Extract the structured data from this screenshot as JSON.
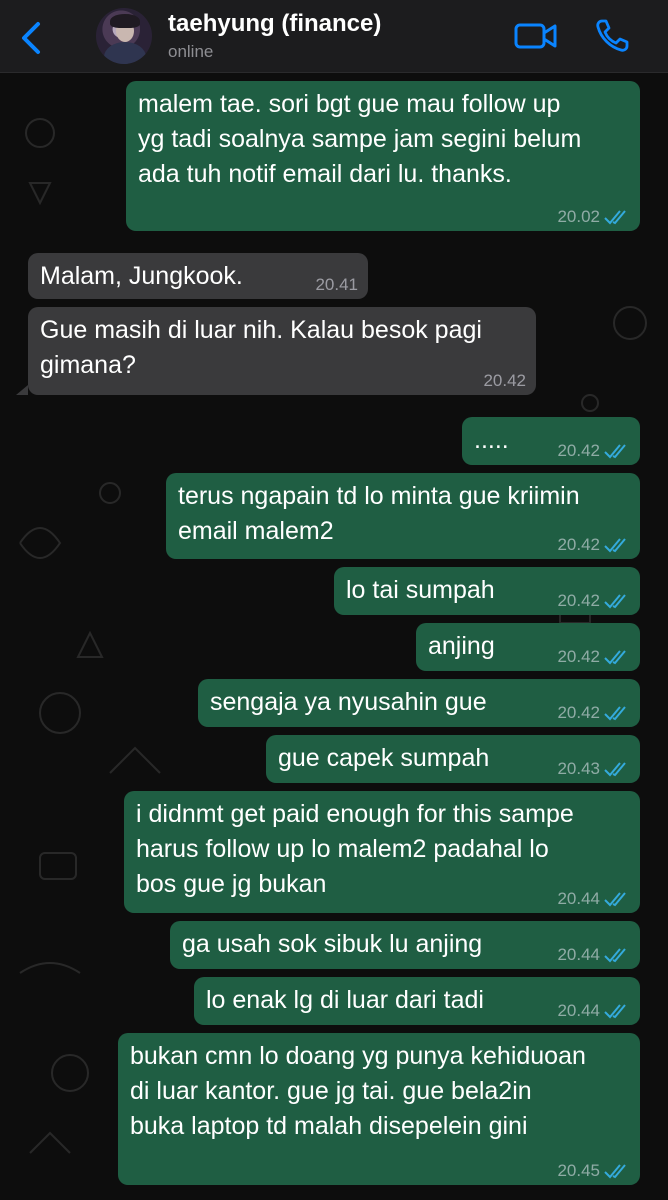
{
  "header": {
    "name": "taehyung (finance)",
    "status": "online"
  },
  "colors": {
    "outgoing_bubble": "#1f5e43",
    "incoming_bubble": "#3a3a3c",
    "accent": "#0a84ff",
    "read_check": "#34aadc"
  },
  "icons": {
    "back": "chevron-left-icon",
    "video": "video-camera-icon",
    "call": "phone-icon",
    "read": "double-check-icon"
  },
  "messages": [
    {
      "dir": "out",
      "text": "malem tae. sori bgt gue mau follow up\nyg tadi soalnya sampe jam segini belum\nada tuh notif email dari lu. thanks.",
      "time": "20.02",
      "read": true
    },
    {
      "dir": "in",
      "text": "Malam, Jungkook.",
      "time": "20.41"
    },
    {
      "dir": "in",
      "text": "Gue masih di luar nih. Kalau besok pagi\ngimana?",
      "time": "20.42"
    },
    {
      "dir": "out",
      "text": ".....",
      "time": "20.42",
      "read": true
    },
    {
      "dir": "out",
      "text": "terus ngapain td lo minta gue kriimin\nemail malem2",
      "time": "20.42",
      "read": true
    },
    {
      "dir": "out",
      "text": "lo tai sumpah",
      "time": "20.42",
      "read": true
    },
    {
      "dir": "out",
      "text": "anjing",
      "time": "20.42",
      "read": true
    },
    {
      "dir": "out",
      "text": "sengaja ya nyusahin gue",
      "time": "20.42",
      "read": true
    },
    {
      "dir": "out",
      "text": "gue capek sumpah",
      "time": "20.43",
      "read": true
    },
    {
      "dir": "out",
      "text": "i didnmt get paid enough for this sampe\nharus follow up lo malem2 padahal lo\nbos gue jg bukan",
      "time": "20.44",
      "read": true
    },
    {
      "dir": "out",
      "text": "ga usah sok sibuk lu anjing",
      "time": "20.44",
      "read": true
    },
    {
      "dir": "out",
      "text": "lo enak lg di luar dari tadi",
      "time": "20.44",
      "read": true
    },
    {
      "dir": "out",
      "text": "bukan cmn lo doang yg punya kehiduoan\ndi luar kantor. gue jg tai. gue bela2in\nbuka laptop td malah disepelein gini",
      "time": "20.45",
      "read": true
    }
  ]
}
